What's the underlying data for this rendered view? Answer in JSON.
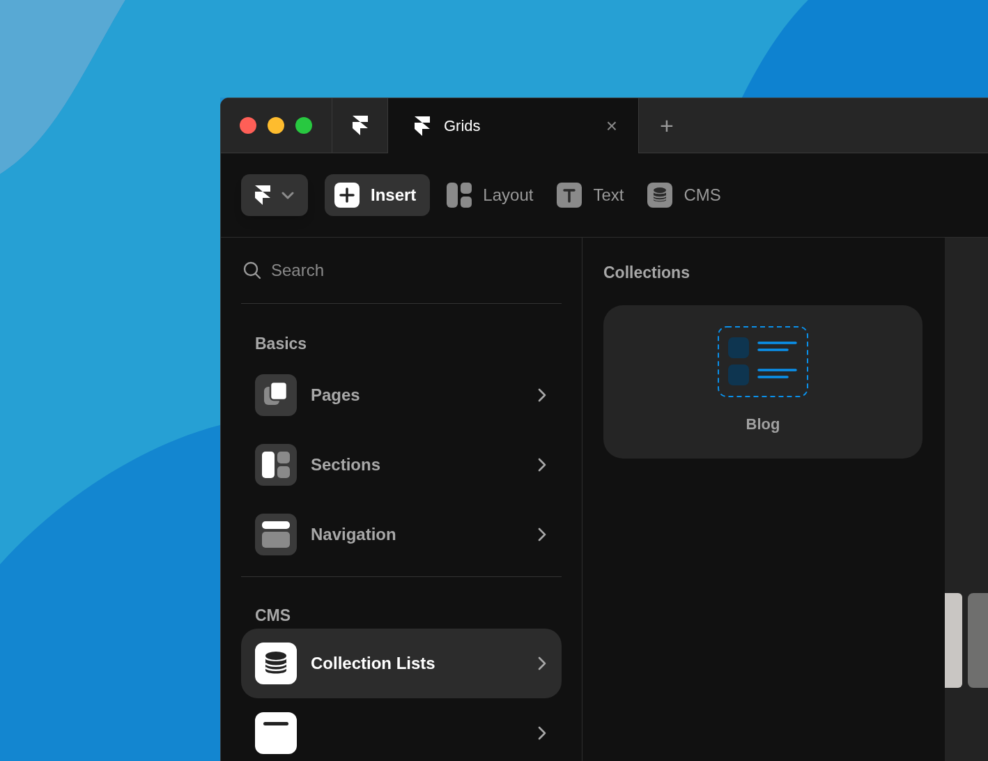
{
  "window": {
    "tabs": [
      {
        "kind": "home",
        "selected": false
      },
      {
        "kind": "doc",
        "label": "Grids",
        "selected": true
      }
    ],
    "close": "×",
    "new_tab": "+"
  },
  "toolbar": [
    {
      "kind": "menu",
      "selected": false
    },
    {
      "kind": "insert",
      "label": "Insert",
      "selected": true
    },
    {
      "kind": "layout",
      "label": "Layout",
      "selected": false
    },
    {
      "kind": "text",
      "label": "Text",
      "selected": false
    },
    {
      "kind": "cms",
      "label": "CMS",
      "selected": false
    }
  ],
  "search": {
    "placeholder": "Search"
  },
  "sections": [
    {
      "title": "Basics",
      "items": [
        {
          "kind": "pages",
          "label": "Pages",
          "selected": false
        },
        {
          "kind": "sections",
          "label": "Sections",
          "selected": false
        },
        {
          "kind": "navigation",
          "label": "Navigation",
          "selected": false
        }
      ]
    },
    {
      "title": "CMS",
      "items": [
        {
          "kind": "cms",
          "label": "Collection Lists",
          "selected": true
        },
        {
          "kind": "fields",
          "selected": false
        }
      ]
    }
  ],
  "collections": {
    "title": "Collections",
    "cards": [
      {
        "label": "Blog"
      }
    ]
  }
}
